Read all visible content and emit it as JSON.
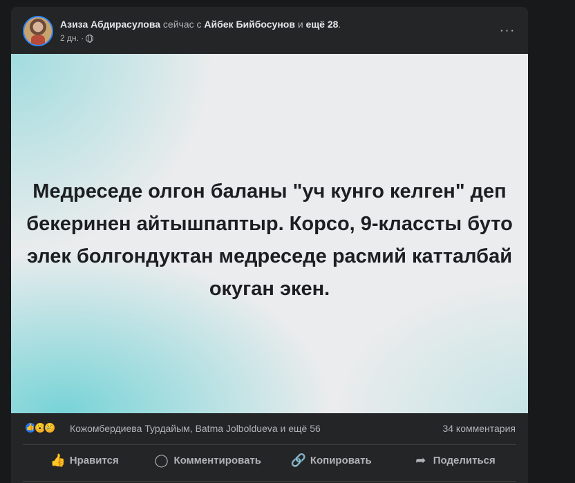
{
  "post": {
    "author": "Азиза Абдирасулова",
    "connector1": " сейчас с ",
    "tagged": "Айбек Бийбосунов",
    "connector2": " и ",
    "others": "ещё 28",
    "period": ".",
    "time": "2 дн. ·",
    "privacy_icon": "globe-icon",
    "more_icon": "more-dots-icon",
    "more_label": "···",
    "image_text": "Медреседе олгон баланы \"уч кунго келген\" деп бекеринен айтышпаптыр. Корсо, 9-классты буто элек болгондуктан медреседе расмий катталбай окуган экен."
  },
  "reactions": {
    "icons": [
      "like-icon",
      "wow-icon",
      "sad-icon"
    ],
    "glyphs": {
      "like": "👍",
      "wow": "😮",
      "sad": "😢"
    },
    "summary": "Кожомбердиева Турдайым, Batma Jolboldueva и ещё 56",
    "comments": "34 комментария"
  },
  "actions": {
    "like_label": "Нравится",
    "comment_label": "Комментировать",
    "copy_label": "Копировать",
    "share_label": "Поделиться",
    "like_glyph": "👍",
    "comment_glyph": "◯",
    "copy_glyph": "🔗",
    "share_glyph": "➦"
  },
  "colors": {
    "background": "#18191a",
    "card": "#242526",
    "text_primary": "#e4e6eb",
    "text_secondary": "#b0b3b8",
    "accent": "#2d88ff",
    "image_teal": "#63cfd3"
  }
}
